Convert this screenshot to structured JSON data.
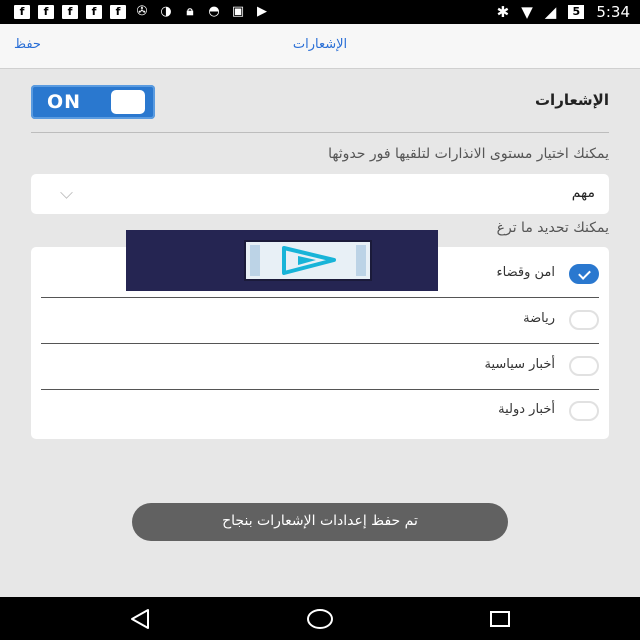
{
  "status_bar": {
    "time": "5:34",
    "battery": "5"
  },
  "header": {
    "save_label": "حفظ",
    "title": "الإشعارات"
  },
  "notifications_row": {
    "label": "الإشعارات",
    "toggle_label": "ON"
  },
  "alert_level": {
    "description": "يمكنك اختيار مستوى الانذارات لتلقيها فور حدوثها",
    "selected": "مهم"
  },
  "categories": {
    "description": "يمكنك تحديد ما ترغ",
    "items": [
      {
        "label": "امن وقضاء",
        "checked": true
      },
      {
        "label": "رياضة",
        "checked": false
      },
      {
        "label": "أخبار سياسية",
        "checked": false
      },
      {
        "label": "أخبار دولية",
        "checked": false
      }
    ]
  },
  "toast": {
    "message": "تم حفظ إعدادات الإشعارات بنجاح"
  },
  "colors": {
    "accent": "#2a78cf",
    "link": "#2a6fd6"
  }
}
